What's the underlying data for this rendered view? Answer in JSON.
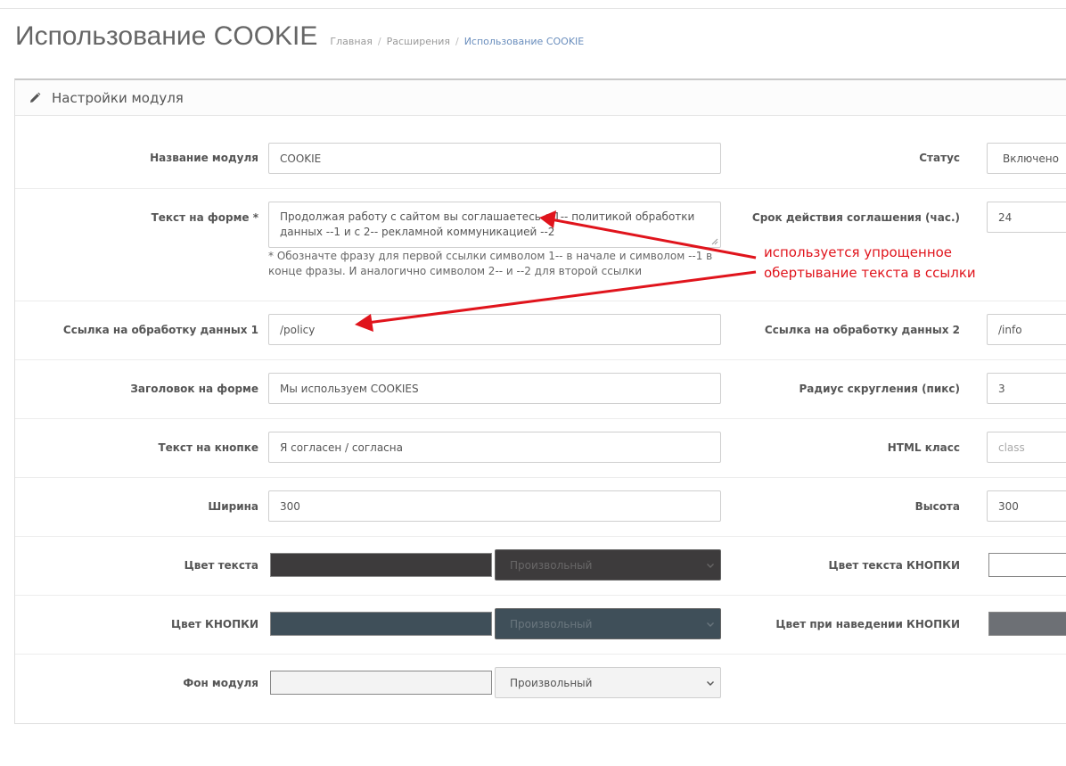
{
  "page": {
    "title": "Использование COOKIE",
    "breadcrumb": [
      "Главная",
      "Расширения",
      "Использование COOKIE"
    ]
  },
  "panel": {
    "icon": "pencil-icon",
    "title": "Настройки модуля"
  },
  "fields": {
    "module_name": {
      "label": "Название модуля",
      "value": "COOKIE"
    },
    "status": {
      "label": "Статус",
      "value": "Включено"
    },
    "form_text": {
      "label": "Текст на форме *",
      "value": "Продолжая работу с сайтом вы соглашаетесь с 1-- политикой обработки данных --1 и с 2-- рекламной коммуникацией --2",
      "help": "* Обозначте фразу для первой ссылки символом 1-- в начале и символом --1 в конце фразы. И аналогично символом 2-- и --2 для второй ссылки"
    },
    "agreement_term": {
      "label": "Срок действия соглашения (час.)",
      "value": "24"
    },
    "link1": {
      "label": "Ссылка на обработку данных 1",
      "value": "/policy"
    },
    "link2": {
      "label": "Ссылка на обработку данных 2",
      "value": "/info"
    },
    "form_heading": {
      "label": "Заголовок на форме",
      "value": "Мы используем COOKIES"
    },
    "radius": {
      "label": "Радиус скругления (пикс)",
      "value": "3"
    },
    "button_text": {
      "label": "Текст на кнопке",
      "value": "Я согласен / согласна"
    },
    "html_class": {
      "label": "HTML класс",
      "placeholder": "class"
    },
    "width": {
      "label": "Ширина",
      "value": "300"
    },
    "height": {
      "label": "Высота",
      "value": "300"
    },
    "text_color": {
      "label": "Цвет текста",
      "color": "#3d3b3c",
      "select": "Произвольный"
    },
    "button_text_color": {
      "label": "Цвет текста КНОПКИ",
      "color": "#ffffff"
    },
    "button_color": {
      "label": "Цвет КНОПКИ",
      "color": "#3f4f59",
      "select": "Произвольный"
    },
    "button_hover_color": {
      "label": "Цвет при наведении КНОПКИ",
      "color": "#6d7075"
    },
    "module_bg": {
      "label": "Фон модуля",
      "color": "#f3f3f3",
      "select": "Произвольный"
    }
  },
  "annotation": {
    "lines": [
      "используется упрощенное",
      "обертывание текста в ссылки"
    ],
    "color": "#e0141c"
  }
}
